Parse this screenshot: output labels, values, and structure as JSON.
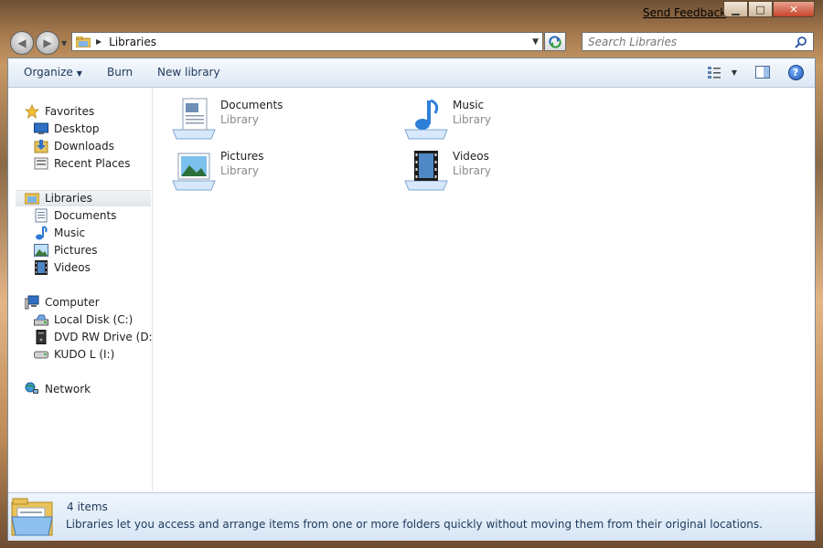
{
  "titlebar": {
    "feedback_link": "Send Feedback",
    "minimize_glyph": "▁",
    "maximize_glyph": "□",
    "close_glyph": "✕"
  },
  "navigation": {
    "back_glyph": "◀",
    "forward_glyph": "▶"
  },
  "address": {
    "crumb": "Libraries",
    "separator_glyph": "▶",
    "dropdown_glyph": "▼"
  },
  "search": {
    "placeholder": "Search Libraries"
  },
  "toolbar": {
    "organize_label": "Organize",
    "burn_label": "Burn",
    "new_library_label": "New library",
    "dropdown_glyph": "▼",
    "help_glyph": "?"
  },
  "nav_pane": {
    "favorites": {
      "label": "Favorites",
      "icon": "star-icon",
      "items": [
        {
          "label": "Desktop",
          "icon": "desktop-icon"
        },
        {
          "label": "Downloads",
          "icon": "downloads-icon"
        },
        {
          "label": "Recent Places",
          "icon": "recent-places-icon"
        }
      ]
    },
    "libraries": {
      "label": "Libraries",
      "icon": "libraries-icon",
      "selected": true,
      "items": [
        {
          "label": "Documents",
          "icon": "documents-icon"
        },
        {
          "label": "Music",
          "icon": "music-icon"
        },
        {
          "label": "Pictures",
          "icon": "pictures-icon"
        },
        {
          "label": "Videos",
          "icon": "videos-icon"
        }
      ]
    },
    "computer": {
      "label": "Computer",
      "icon": "computer-icon",
      "items": [
        {
          "label": "Local Disk (C:)",
          "icon": "hard-disk-icon"
        },
        {
          "label": "DVD RW Drive (D:) Q",
          "icon": "dvd-drive-icon"
        },
        {
          "label": "KUDO L (I:)",
          "icon": "usb-drive-icon"
        }
      ]
    },
    "network": {
      "label": "Network",
      "icon": "network-icon"
    }
  },
  "libraries": [
    {
      "name": "Documents",
      "type": "Library",
      "icon": "documents-library-icon"
    },
    {
      "name": "Music",
      "type": "Library",
      "icon": "music-library-icon"
    },
    {
      "name": "Pictures",
      "type": "Library",
      "icon": "pictures-library-icon"
    },
    {
      "name": "Videos",
      "type": "Library",
      "icon": "videos-library-icon"
    }
  ],
  "details_pane": {
    "count": "4 items",
    "description": "Libraries let you access and arrange items from one or more folders quickly without moving them from their original locations."
  },
  "colors": {
    "accent": "#1e395b",
    "toolbar_top": "#f6f9fd",
    "toolbar_bottom": "#dce7f4",
    "muted": "#8a8a8a"
  }
}
